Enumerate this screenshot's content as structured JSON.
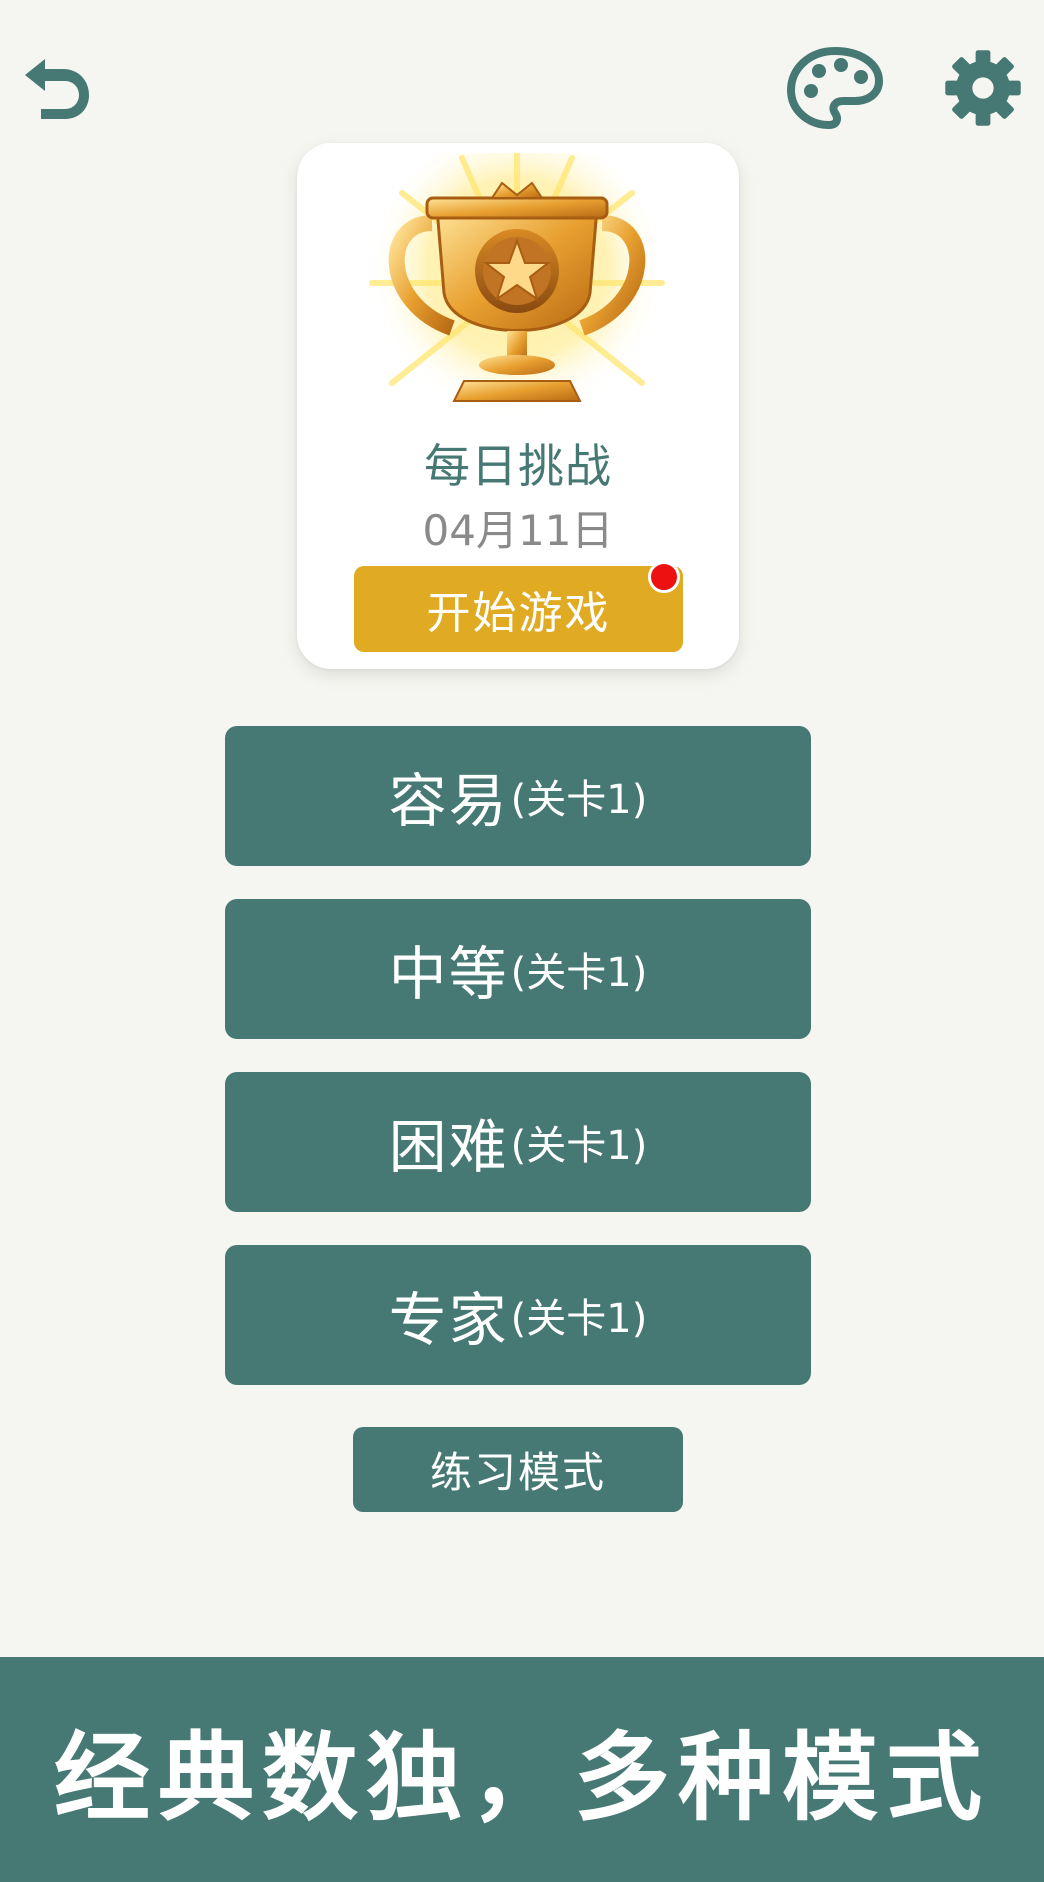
{
  "colors": {
    "background": "#f5f6f1",
    "primary": "#467874",
    "accent_gold": "#e0aa22",
    "notification_red": "#ee1111"
  },
  "header": {
    "back_icon": "undo-arrow-icon",
    "theme_icon": "palette-icon",
    "settings_icon": "gear-icon"
  },
  "daily_challenge": {
    "icon": "trophy-icon",
    "title": "每日挑战",
    "date": "04月11日",
    "start_label": "开始游戏",
    "has_notification": true
  },
  "levels": [
    {
      "name": "容易",
      "sub": "(关卡1)"
    },
    {
      "name": "中等",
      "sub": "(关卡1)"
    },
    {
      "name": "困难",
      "sub": "(关卡1)"
    },
    {
      "name": "专家",
      "sub": "(关卡1)"
    }
  ],
  "practice_label": "练习模式",
  "banner_text": "经典数独，多种模式"
}
